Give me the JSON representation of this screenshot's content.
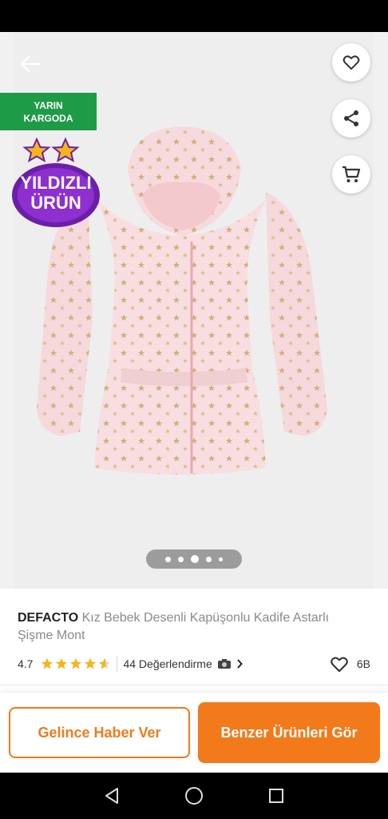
{
  "product": {
    "brand": "DEFACTO",
    "name": "Kız Bebek Desenli Kapüşonlu Kadife Astarlı Şişme Mont"
  },
  "badges": {
    "cargo_line1": "YARIN",
    "cargo_line2": "KARGODA",
    "star_line1": "YILDIZLI",
    "star_line2": "ÜRÜN"
  },
  "rating": {
    "score": "4.7",
    "stars": 4.7,
    "reviews": "44 Değerlendirme",
    "favorites": "6B"
  },
  "carousel": {
    "count": 5,
    "active": 3
  },
  "actions": {
    "notify": "Gelince Haber Ver",
    "similar": "Benzer Ürünleri Gör"
  },
  "colors": {
    "accent": "#f27a1a",
    "cargo_badge": "#1e9b47",
    "star_yellow": "#f5b51b",
    "badge_purple": "#6b1fa8"
  },
  "icons": {
    "back": "arrow-left-icon",
    "favorite": "heart-outline-icon",
    "share": "share-icon",
    "cart": "cart-icon",
    "camera": "camera-icon",
    "chevron": "chevron-right-icon"
  }
}
